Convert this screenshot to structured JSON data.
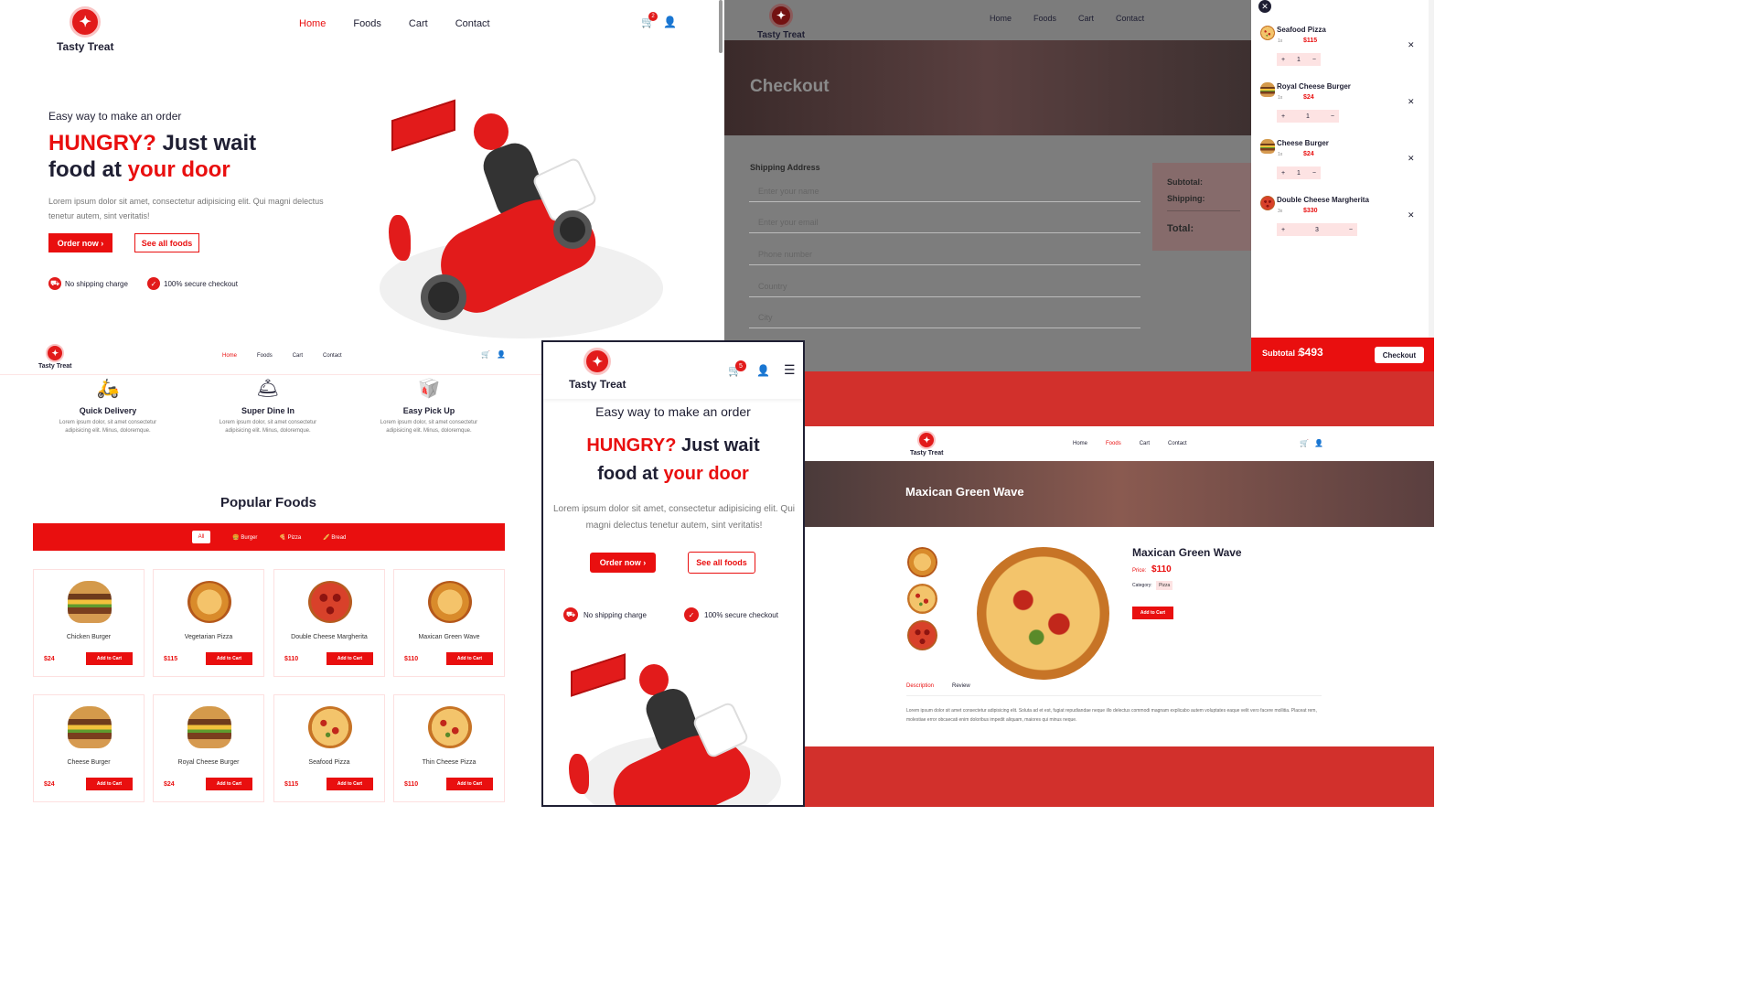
{
  "brand": {
    "name": "Tasty Treat"
  },
  "nav": {
    "home": "Home",
    "foods": "Foods",
    "cart": "Cart",
    "contact": "Contact"
  },
  "hero": {
    "subtitle": "Easy way to make an order",
    "title_hungry": "HUNGRY?",
    "title_just_wait": " Just wait",
    "title_food_at": "food at ",
    "title_your_door": "your door",
    "description": "Lorem ipsum dolor sit amet, consectetur adipisicing elit. Qui magni delectus tenetur autem, sint veritatis!",
    "order_btn": "Order now ›",
    "see_all_btn": "See all foods",
    "feature1": "No shipping charge",
    "feature2": "100% secure checkout"
  },
  "cart_badge": "2",
  "mobile_cart_badge": "5",
  "checkout": {
    "title": "Checkout",
    "shipping_heading": "Shipping Address",
    "placeholders": [
      "Enter your name",
      "Enter your email",
      "Phone number",
      "Country",
      "City"
    ],
    "subtotal_label": "Subtotal:",
    "shipping_label": "Shipping:",
    "total_label": "Total:"
  },
  "cart_drawer": {
    "items": [
      {
        "name": "Seafood Pizza",
        "qty_label": "1x",
        "price": "$115",
        "qty": "1"
      },
      {
        "name": "Royal Cheese Burger",
        "qty_label": "1x",
        "price": "$24",
        "qty": "1"
      },
      {
        "name": "Cheese Burger",
        "qty_label": "1x",
        "price": "$24",
        "qty": "1"
      },
      {
        "name": "Double Cheese Margherita",
        "qty_label": "3x",
        "price": "$330",
        "qty": "3"
      }
    ],
    "subtotal_label": "Subtotal :",
    "subtotal_value": "$493",
    "checkout_btn": "Checkout"
  },
  "services": [
    {
      "title": "Quick Delivery",
      "text": "Lorem ipsum dolor, sit amet consectetur adipisicing elit. Minus, doloremque."
    },
    {
      "title": "Super Dine In",
      "text": "Lorem ipsum dolor, sit amet consectetur adipisicing elit. Minus, doloremque."
    },
    {
      "title": "Easy Pick Up",
      "text": "Lorem ipsum dolor, sit amet consectetur adipisicing elit. Minus, doloremque."
    }
  ],
  "popular": {
    "title": "Popular Foods",
    "filters": [
      "All",
      "Burger",
      "Pizza",
      "Bread"
    ],
    "add_btn": "Add to Cart",
    "foods": [
      {
        "name": "Chicken Burger",
        "price": "$24",
        "kind": "burger"
      },
      {
        "name": "Vegetarian Pizza",
        "price": "$115",
        "kind": "pizza"
      },
      {
        "name": "Double Cheese Margherita",
        "price": "$110",
        "kind": "pizza3"
      },
      {
        "name": "Maxican Green Wave",
        "price": "$110",
        "kind": "pizza"
      },
      {
        "name": "Cheese Burger",
        "price": "$24",
        "kind": "burger"
      },
      {
        "name": "Royal Cheese Burger",
        "price": "$24",
        "kind": "burger"
      },
      {
        "name": "Seafood Pizza",
        "price": "$115",
        "kind": "pizza2"
      },
      {
        "name": "Thin Cheese Pizza",
        "price": "$110",
        "kind": "pizza2"
      }
    ]
  },
  "product": {
    "banner_title": "Maxican Green Wave",
    "name": "Maxican Green Wave",
    "price_label": "Price:",
    "price": "$110",
    "category_label": "Category:",
    "category": "Pizza",
    "add_btn": "Add to Cart",
    "tab_description": "Description",
    "tab_review": "Review",
    "description": "Lorem ipsum dolor sit amet consectetur adipisicing elit. Soluta ad et est, fugiat repudiandae neque illo delectus commodi magnam explicabo autem voluptates eaque velit vero facere mollitia. Placeat rem, molestiae error obcaecati enim doloribus impedit aliquam, maiores qui minus neque."
  },
  "colors": {
    "accent": "#e90f0f",
    "dark": "#1f1f33",
    "backdrop": "#d2302c"
  }
}
